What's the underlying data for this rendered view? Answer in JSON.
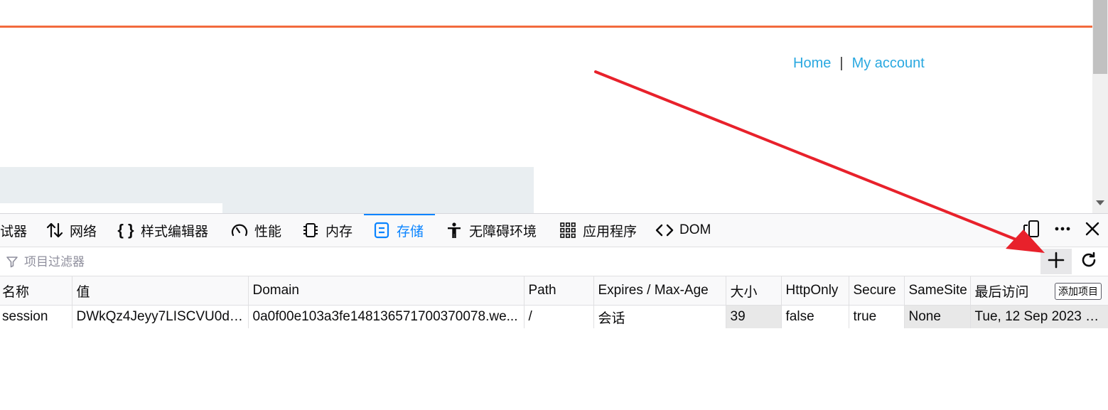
{
  "page": {
    "nav": {
      "home": "Home",
      "separator": "|",
      "account": "My account"
    },
    "accent_color": "#f26a3d",
    "link_color": "#29a8e0"
  },
  "devtools": {
    "tabs": [
      {
        "label": "试器",
        "icon": "inspector-icon"
      },
      {
        "label": "网络",
        "icon": "network-arrows-icon"
      },
      {
        "label": "样式编辑器",
        "icon": "braces-icon"
      },
      {
        "label": "性能",
        "icon": "gauge-icon"
      },
      {
        "label": "内存",
        "icon": "memory-chip-icon"
      },
      {
        "label": "存储",
        "icon": "storage-icon",
        "selected": true
      },
      {
        "label": "无障碍环境",
        "icon": "accessibility-icon"
      },
      {
        "label": "应用程序",
        "icon": "grid-icon"
      },
      {
        "label": "DOM",
        "icon": "code-brackets-icon"
      }
    ],
    "filter_placeholder": "项目过滤器",
    "add_tooltip": "添加项目",
    "columns": [
      "名称",
      "值",
      "Domain",
      "Path",
      "Expires / Max-Age",
      "大小",
      "HttpOnly",
      "Secure",
      "SameSite",
      "最后访问"
    ],
    "rows": [
      [
        "session",
        "DWkQz4Jeyy7LISCVU0dj...",
        "0a0f00e103a3fe148136571700370078.we...",
        "/",
        "会话",
        "39",
        "false",
        "true",
        "None",
        "Tue, 12 Sep 2023 1..."
      ]
    ],
    "selected_color": "#0a84ff"
  },
  "annotation": {
    "color": "#e8212b",
    "icon": "red-arrow"
  }
}
